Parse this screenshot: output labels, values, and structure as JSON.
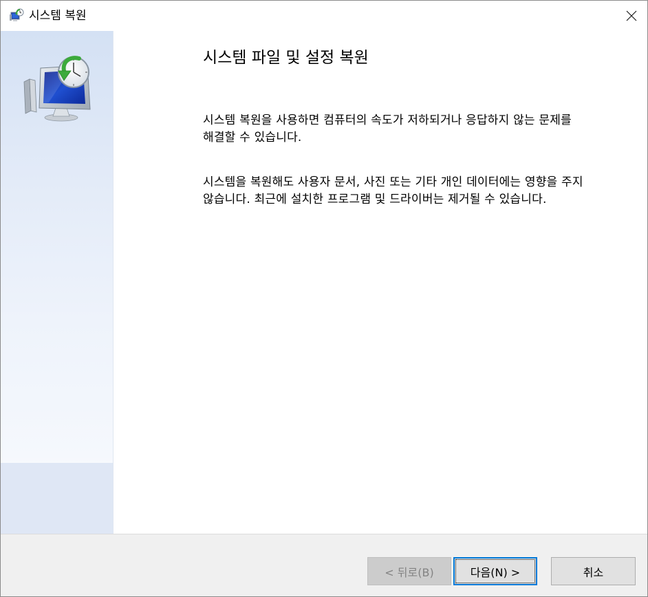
{
  "window": {
    "title": "시스템 복원",
    "icon": "system-restore-icon"
  },
  "titlebar": {
    "close_icon": "close-icon"
  },
  "main": {
    "heading": "시스템 파일 및 설정 복원",
    "paragraph1": "시스템 복원을 사용하면 컴퓨터의 속도가 저하되거나 응답하지 않는 문제를 해결할 수 있습니다.",
    "paragraph2": "시스템을 복원해도 사용자 문서, 사진 또는 기타 개인 데이터에는 영향을 주지 않습니다. 최근에 설치한 프로그램 및 드라이버는 제거될 수 있습니다."
  },
  "footer": {
    "back_label": "< 뒤로(B)",
    "next_label": "다음(N) >",
    "cancel_label": "취소"
  },
  "colors": {
    "accent": "#0078d7",
    "sidebar_top": "#d4e1f4",
    "sidebar_bottom": "#dfe7f5",
    "footer_bg": "#f0f0f0",
    "disabled_text": "#838383"
  }
}
